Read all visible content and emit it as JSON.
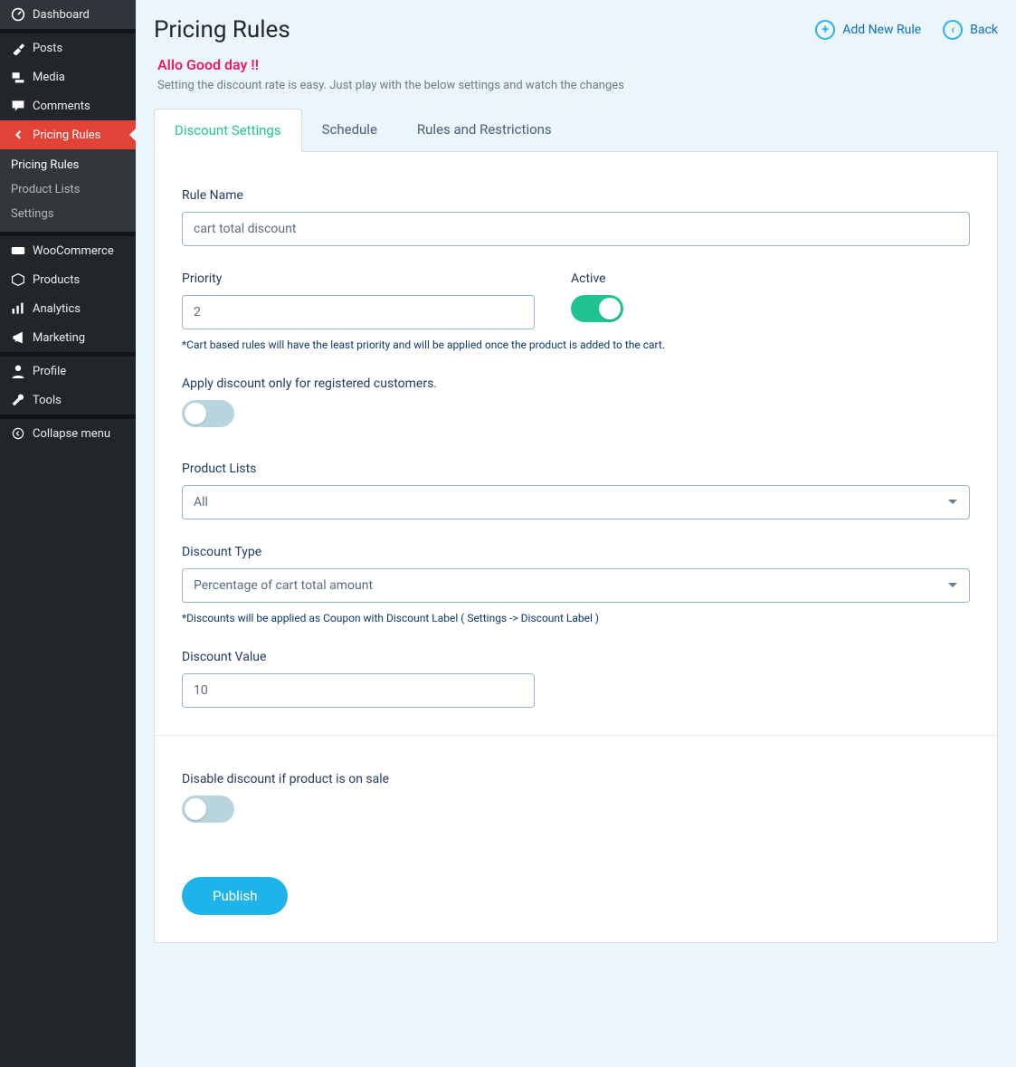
{
  "sidebar": {
    "items": [
      {
        "label": "Dashboard",
        "icon": "dashboard"
      },
      {
        "label": "Posts",
        "icon": "pin"
      },
      {
        "label": "Media",
        "icon": "media"
      },
      {
        "label": "Comments",
        "icon": "comment"
      },
      {
        "label": "Pricing Rules",
        "icon": "back",
        "active": true
      },
      {
        "label": "WooCommerce",
        "icon": "woo"
      },
      {
        "label": "Products",
        "icon": "box"
      },
      {
        "label": "Analytics",
        "icon": "bars"
      },
      {
        "label": "Marketing",
        "icon": "mega"
      },
      {
        "label": "Profile",
        "icon": "user"
      },
      {
        "label": "Tools",
        "icon": "wrench"
      },
      {
        "label": "Collapse menu",
        "icon": "collapse"
      }
    ],
    "sub": [
      "Pricing Rules",
      "Product Lists",
      "Settings"
    ]
  },
  "header": {
    "title": "Pricing Rules",
    "add": "Add New Rule",
    "back": "Back"
  },
  "intro": {
    "greet": "Allo Good day !!",
    "desc": "Setting the discount rate is easy. Just play with the below settings and watch the changes"
  },
  "tabs": [
    "Discount Settings",
    "Schedule",
    "Rules and Restrictions"
  ],
  "form": {
    "rule_name_label": "Rule Name",
    "rule_name_value": "cart total discount",
    "priority_label": "Priority",
    "priority_value": "2",
    "active_label": "Active",
    "priority_note": "*Cart based rules will have the least priority and will be applied once the product is added to the cart.",
    "registered_label": "Apply discount only for registered customers.",
    "product_lists_label": "Product Lists",
    "product_lists_value": "All",
    "discount_type_label": "Discount Type",
    "discount_type_value": "Percentage of cart total amount",
    "discount_type_note": "*Discounts will be applied as Coupon with Discount Label ( Settings -> Discount Label )",
    "discount_value_label": "Discount Value",
    "discount_value_value": "10",
    "disable_sale_label": "Disable discount if product is on sale",
    "publish": "Publish"
  }
}
